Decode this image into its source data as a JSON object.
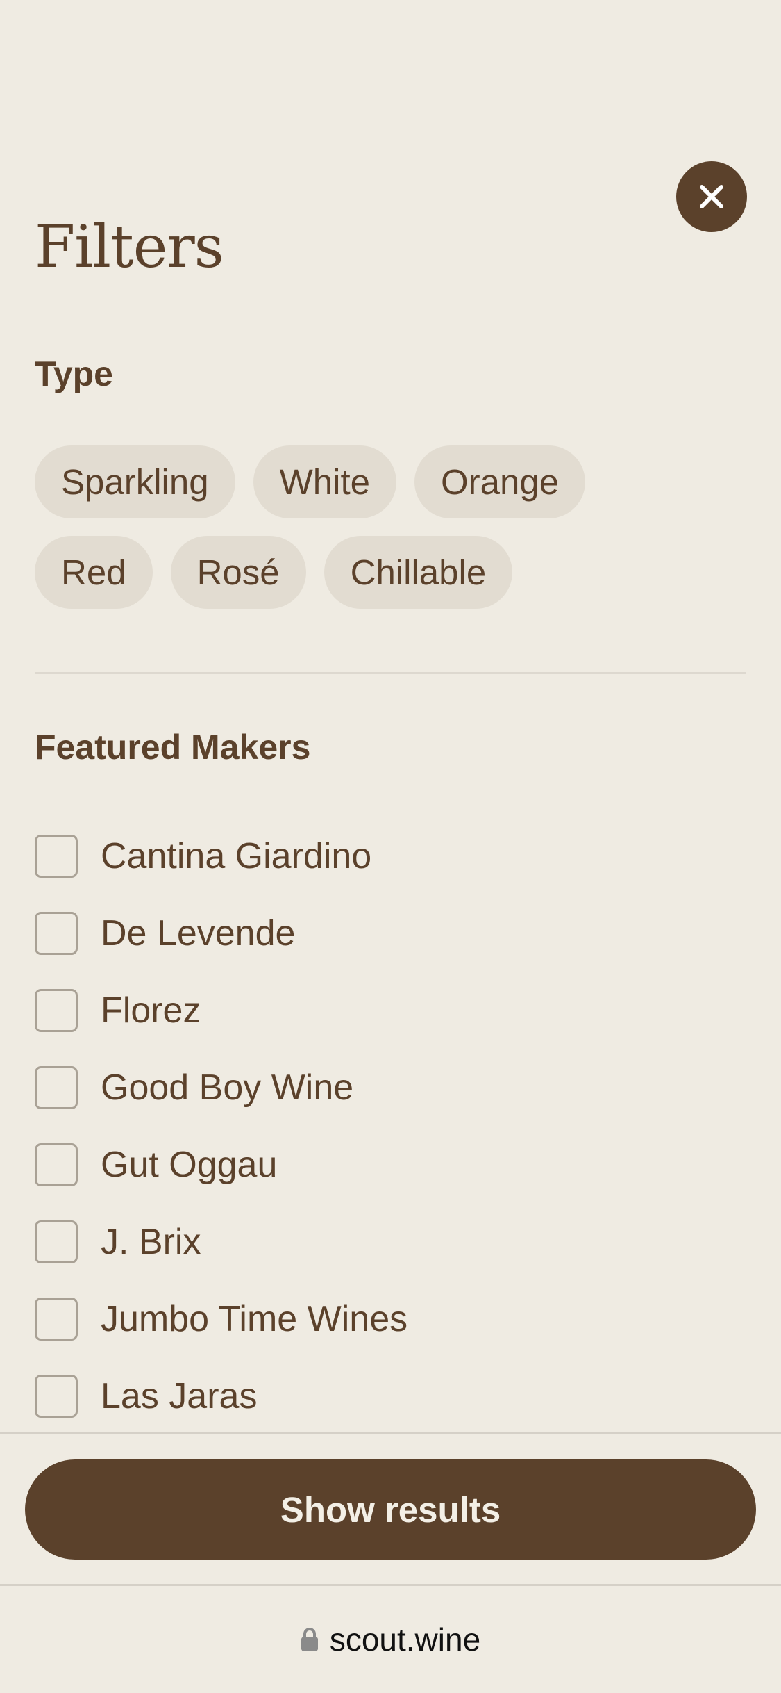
{
  "header": {
    "title": "Filters",
    "close_icon": "close-icon"
  },
  "type_section": {
    "heading": "Type",
    "chips": [
      {
        "label": "Sparkling"
      },
      {
        "label": "White"
      },
      {
        "label": "Orange"
      },
      {
        "label": "Red"
      },
      {
        "label": "Rosé"
      },
      {
        "label": "Chillable"
      }
    ]
  },
  "makers_section": {
    "heading": "Featured Makers",
    "items": [
      {
        "label": "Cantina Giardino",
        "checked": false
      },
      {
        "label": "De Levende",
        "checked": false
      },
      {
        "label": "Florez",
        "checked": false
      },
      {
        "label": "Good Boy Wine",
        "checked": false
      },
      {
        "label": "Gut Oggau",
        "checked": false
      },
      {
        "label": "J. Brix",
        "checked": false
      },
      {
        "label": "Jumbo Time Wines",
        "checked": false
      },
      {
        "label": "Las Jaras",
        "checked": false
      }
    ]
  },
  "footer": {
    "show_results_label": "Show results"
  },
  "browser": {
    "url": "scout.wine",
    "lock_icon": "lock-icon"
  },
  "colors": {
    "background": "#efebe2",
    "brand_brown": "#5b412b",
    "chip_background": "#e2dcd1"
  }
}
